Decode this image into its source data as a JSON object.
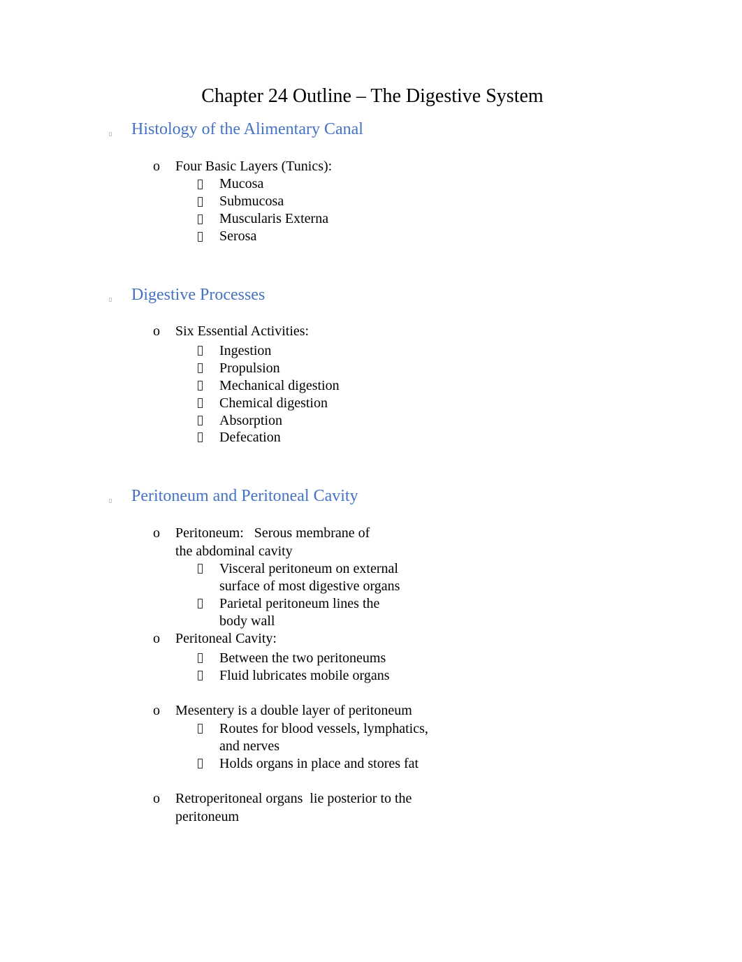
{
  "document": {
    "title": "Chapter 24 Outline – The Digestive System",
    "accent_color": "#4472c4",
    "sections": [
      {
        "heading": "Histology of the Alimentary Canal",
        "items": [
          {
            "text": "Four Basic Layers (Tunics):",
            "subitems": [
              "Mucosa",
              "Submucosa",
              "Muscularis Externa",
              "Serosa"
            ]
          }
        ]
      },
      {
        "heading": "Digestive Processes",
        "items": [
          {
            "text": "Six Essential Activities:",
            "subitems": [
              "Ingestion",
              "Propulsion",
              "Mechanical digestion",
              "Chemical digestion",
              "Absorption",
              "Defecation"
            ]
          }
        ]
      },
      {
        "heading": "Peritoneum and Peritoneal Cavity",
        "items": [
          {
            "text_lines": [
              "Peritoneum:   Serous membrane of",
              "the abdominal cavity"
            ],
            "subitems": [
              [
                "Visceral peritoneum on external",
                "surface of most digestive organs"
              ],
              [
                "Parietal peritoneum lines the",
                "body wall"
              ]
            ]
          },
          {
            "text": "Peritoneal Cavity:",
            "subitems": [
              "Between the two peritoneums",
              "Fluid lubricates mobile organs"
            ]
          },
          {
            "text": "Mesentery is a double layer of peritoneum",
            "subitems": [
              [
                "Routes for blood vessels, lymphatics,",
                "and nerves"
              ],
              "Holds organs in place and stores fat"
            ]
          },
          {
            "text_lines": [
              "Retroperitoneal organs  lie posterior to the",
              "peritoneum"
            ]
          }
        ]
      }
    ],
    "bullets": {
      "level1": "o",
      "heading": "▯"
    }
  }
}
